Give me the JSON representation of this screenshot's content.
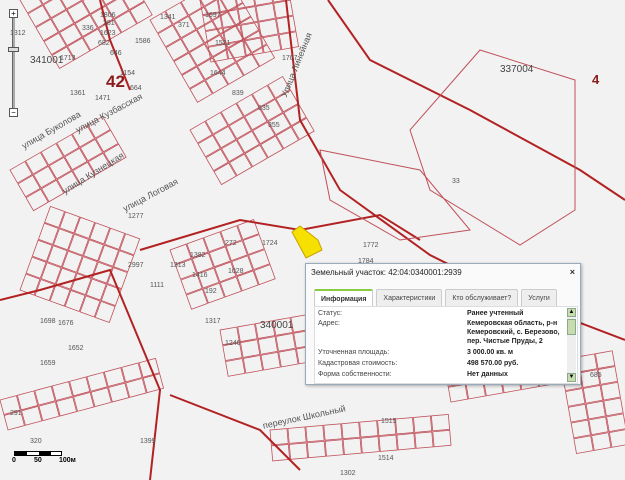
{
  "map": {
    "block_labels": [
      "341001",
      "337004",
      "340001"
    ],
    "region_labels": [
      "42",
      "4"
    ],
    "streets": [
      "Улица Линейная",
      "улица Кузбасская",
      "улица Буколова",
      "улица Кузнецкая",
      "улица Логовая",
      "переулок Школьный"
    ],
    "parcels": [
      "1806",
      "682",
      "1312",
      "1713",
      "336",
      "1623",
      "281",
      "1586",
      "646",
      "1154",
      "664",
      "1361",
      "1471",
      "1341",
      "371",
      "1697",
      "1521",
      "1644",
      "1707",
      "839",
      "835",
      "355",
      "33",
      "1724",
      "1772",
      "1784",
      "272",
      "1382",
      "1416",
      "1028",
      "192",
      "1313",
      "2997",
      "1111",
      "1317",
      "1246",
      "1698",
      "1676",
      "1652",
      "1659",
      "1399",
      "1515",
      "1514",
      "685",
      "291",
      "320",
      "1302",
      "1277"
    ]
  },
  "zoom_control": {
    "plus": "+",
    "minus": "−"
  },
  "scale": {
    "zero": "0",
    "mid": "50",
    "end": "100м"
  },
  "popup": {
    "title": "Земельный участок: 42:04:0340001:2939",
    "close": "×",
    "tabs": [
      "Информация",
      "Характеристики",
      "Кто обслуживает?",
      "Услуги"
    ],
    "rows": [
      {
        "label": "Статус:",
        "value": "Ранее учтенный"
      },
      {
        "label": "Адрес:",
        "value": "Кемеровская область, р-н Кемеровский, с. Березово, пер. Чистые Пруды, 2"
      },
      {
        "label": "Уточненная площадь:",
        "value": "3 000.00 кв. м"
      },
      {
        "label": "Кадастровая стоимость:",
        "value": "498 570.00 руб."
      },
      {
        "label": "Форма собственности:",
        "value": "Нет данных"
      }
    ]
  },
  "colors": {
    "parcel": "#c0505a",
    "boundary": "#b22222",
    "highlight": "#f5e000"
  }
}
